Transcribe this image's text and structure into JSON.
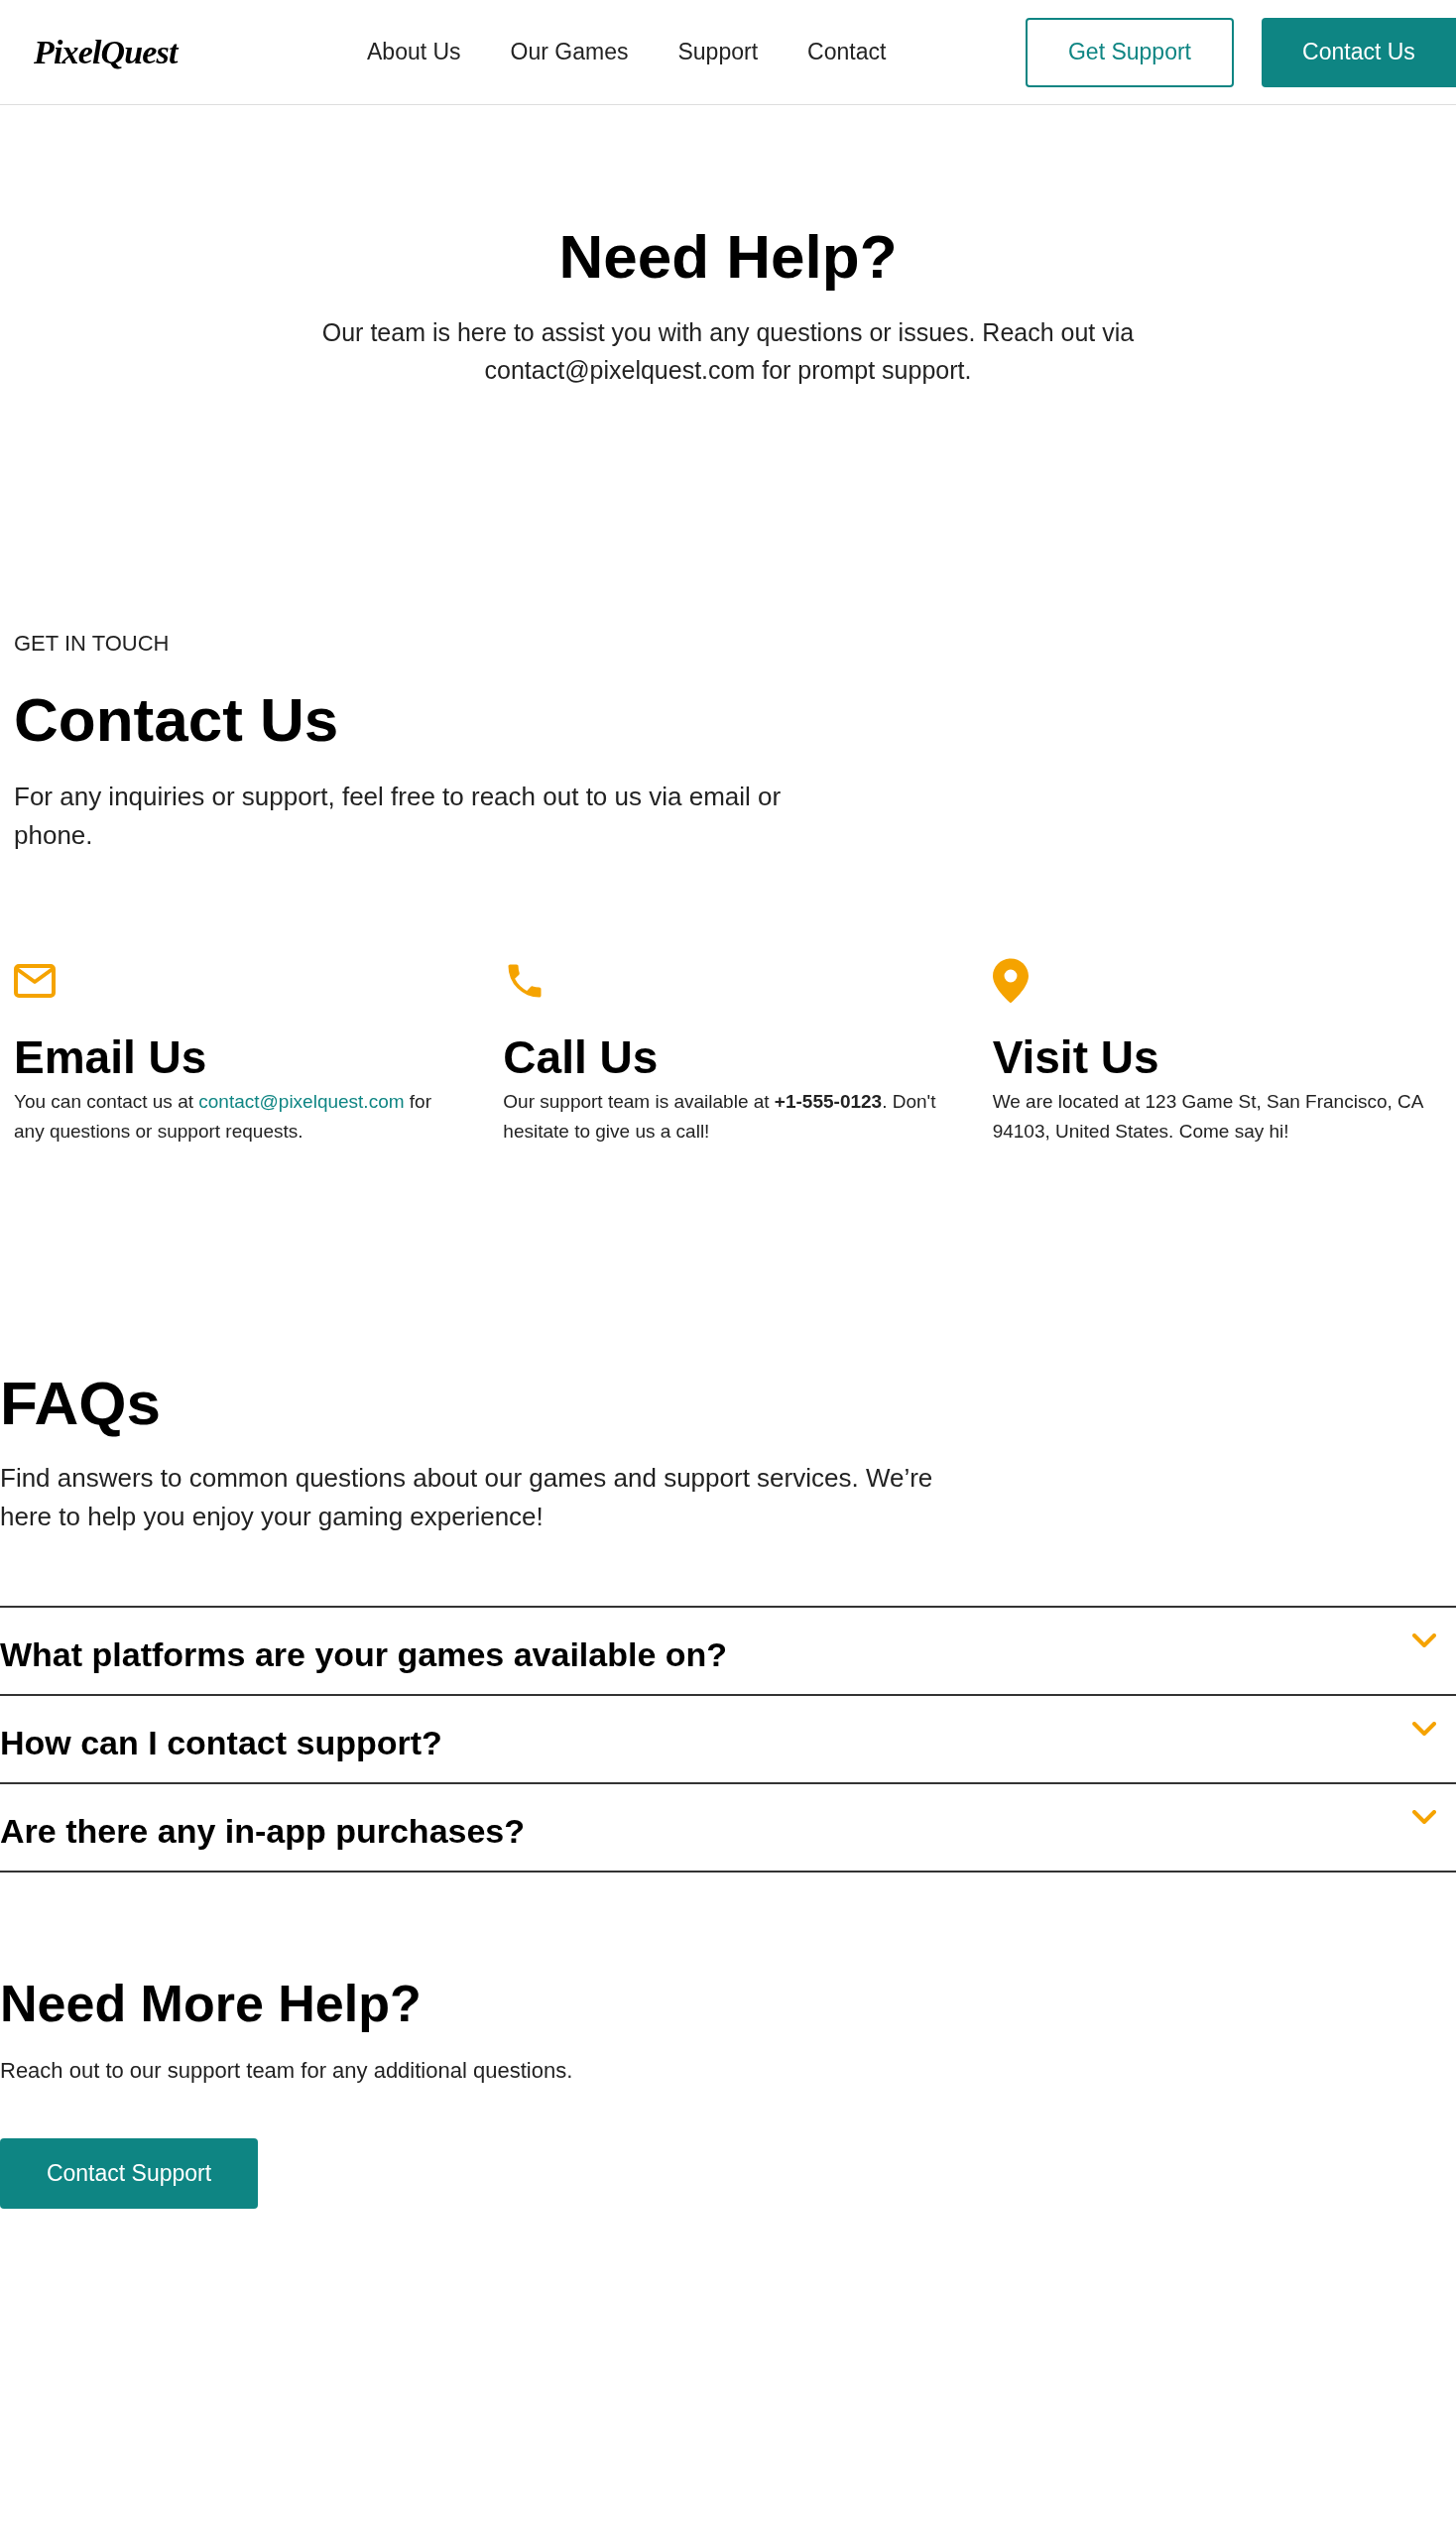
{
  "header": {
    "logo": "PixelQuest",
    "nav": [
      "About Us",
      "Our Games",
      "Support",
      "Contact"
    ],
    "buttons": [
      {
        "label": "Get Support",
        "kind": "outline"
      },
      {
        "label": "Contact Us",
        "kind": "filled"
      }
    ]
  },
  "hero": {
    "title": "Need Help?",
    "text": "Our team is here to assist you with any questions or issues. Reach out via contact@pixelquest.com for prompt support."
  },
  "contact": {
    "eyebrow": "GET IN TOUCH",
    "title": "Contact Us",
    "text": "For any inquiries or support, feel free to reach out to us via email or phone.",
    "cards": [
      {
        "kind": "email",
        "title": "Email Us",
        "before": "You can contact us at ",
        "link": "contact@pixelquest.com",
        "after": " for any questions or support requests."
      },
      {
        "kind": "phone",
        "title": "Call Us",
        "before": "Our support team is available at **+1-555-0123**. Don't hesitate to give us a call!"
      },
      {
        "kind": "location",
        "title": "Visit Us",
        "before": "We are located at 123 Game St, San Francisco, CA 94103, United States. Come say hi!"
      }
    ]
  },
  "faqs": {
    "title": "FAQs",
    "text": "Find answers to common questions about our games and support services. We’re here to help you enjoy your gaming experience!",
    "items": [
      {
        "question": "What platforms are your games available on?",
        "expanded": false
      },
      {
        "question": "How can I contact support?",
        "expanded": false
      },
      {
        "question": "Are there any in-app purchases?",
        "expanded": false
      }
    ]
  },
  "more_help": {
    "title": "Need More Help?",
    "text": "Reach out to our support team for any additional questions.",
    "button": "Contact Support"
  }
}
